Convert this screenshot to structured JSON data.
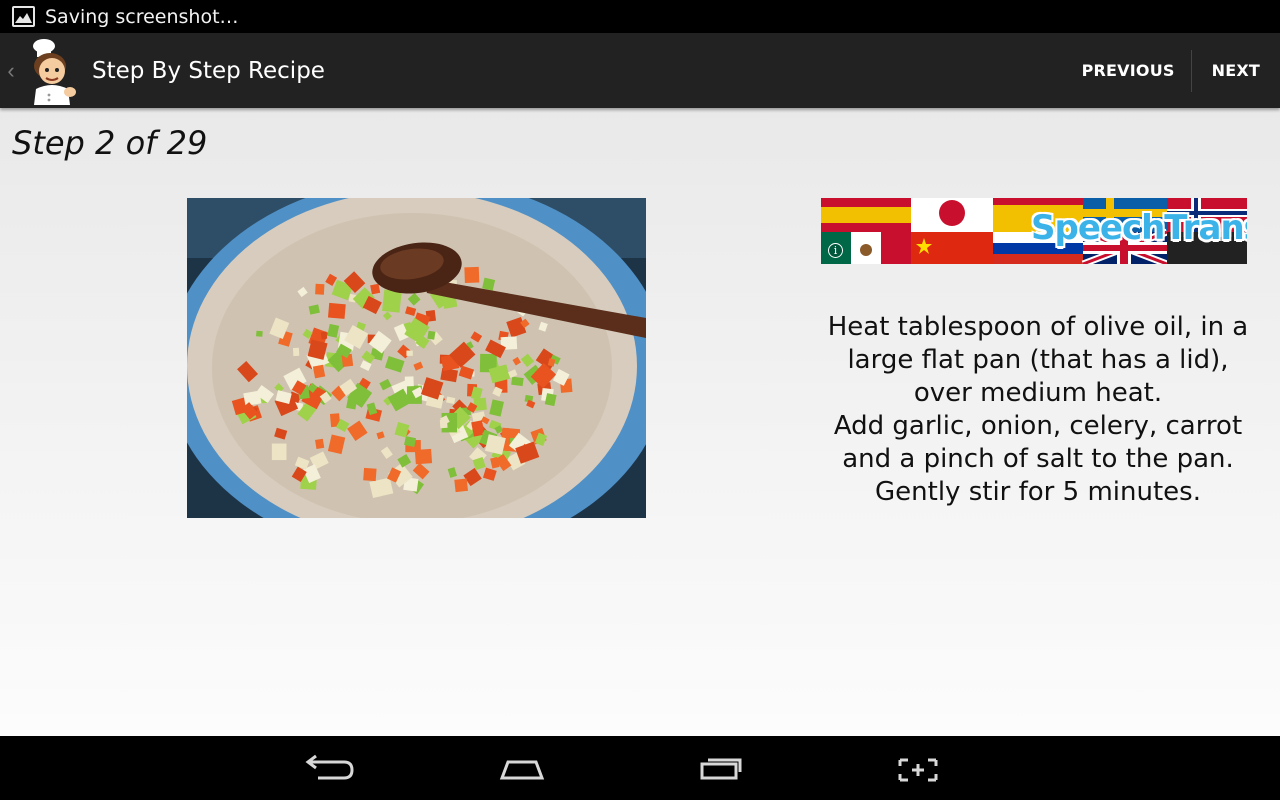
{
  "status_bar": {
    "notification_text": "Saving screenshot…",
    "notification_icon": "image-icon"
  },
  "action_bar": {
    "title": "Step By Step Recipe",
    "logo_icon": "chef-icon",
    "previous_label": "PREVIOUS",
    "next_label": "NEXT"
  },
  "step": {
    "title": "Step 2 of 29",
    "instructions": "Heat tablespoon of olive oil, in a\nlarge flat pan (that has a lid),\nover medium heat.\nAdd garlic, onion, celery, carrot\nand a pinch of salt to the pan.\nGently stir for 5 minutes."
  },
  "ad": {
    "brand": "SpeechTrans",
    "info_icon": "info-icon"
  },
  "nav_bar": {
    "back_icon": "back-icon",
    "home_icon": "home-icon",
    "recents_icon": "recents-icon",
    "screenshot_icon": "screenshot-icon"
  },
  "colors": {
    "action_bar_bg": "#222222",
    "ad_text": "#3bb3e8",
    "content_bg_top": "#e9e9e9",
    "content_bg_bottom": "#fcfcfc"
  }
}
